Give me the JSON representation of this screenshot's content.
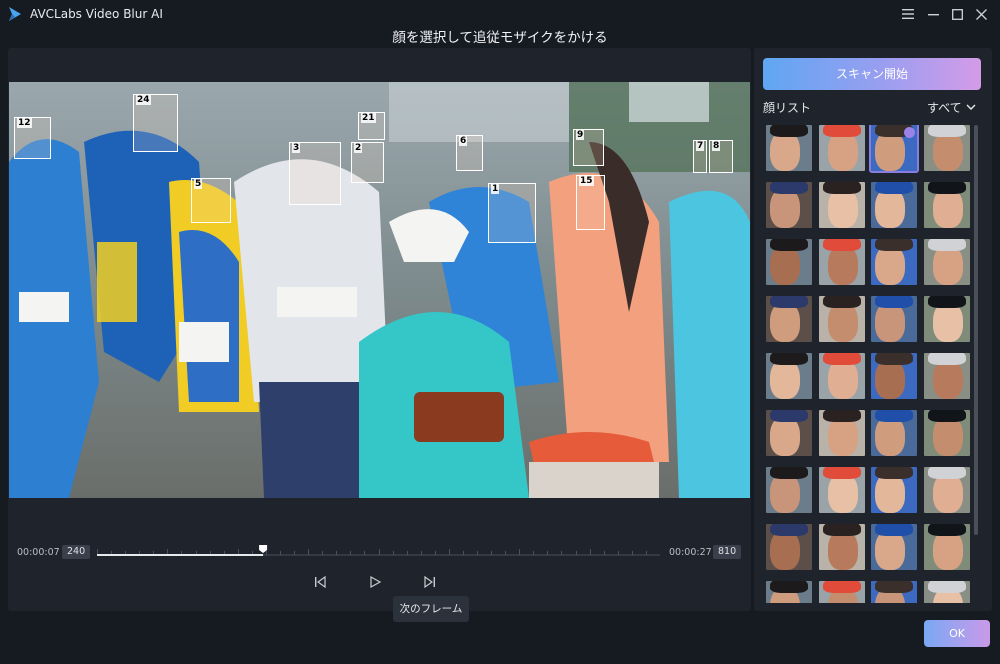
{
  "window": {
    "title": "AVCLabs Video Blur AI",
    "subtitle": "顔を選択して追従モザイクをかける"
  },
  "player": {
    "current_time": "00:00:07",
    "current_frame": "240",
    "end_time": "00:00:27",
    "end_frame": "810",
    "tooltip": "次のフレーム",
    "progress": 0.295
  },
  "faces": [
    {
      "num": "12"
    },
    {
      "num": "24"
    },
    {
      "num": "21"
    },
    {
      "num": "3"
    },
    {
      "num": "2"
    },
    {
      "num": "6"
    },
    {
      "num": "9"
    },
    {
      "num": "7"
    },
    {
      "num": "8"
    },
    {
      "num": "5"
    },
    {
      "num": "1"
    },
    {
      "num": "15"
    }
  ],
  "sidebar": {
    "scan_label": "スキャン開始",
    "list_title": "顔リスト",
    "filter_label": "すべて"
  },
  "footer": {
    "ok_label": "OK"
  },
  "colors": {
    "background": "#161a21",
    "panel": "#1f242c",
    "accent_start": "#5fa6f2",
    "accent_end": "#d49be8"
  }
}
